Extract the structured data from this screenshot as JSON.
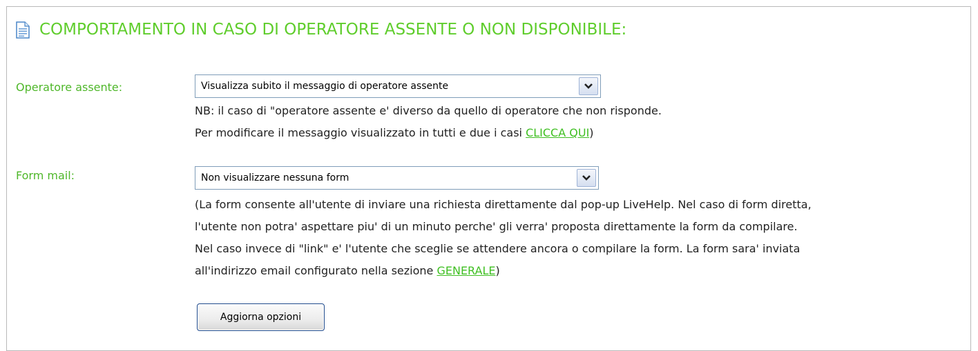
{
  "section": {
    "title": "COMPORTAMENTO IN CASO DI OPERATORE ASSENTE O NON DISPONIBILE:",
    "icon": "document-icon"
  },
  "operatore_assente": {
    "label": "Operatore assente:",
    "selected": "Visualizza subito il messaggio di operatore assente",
    "note_line1": "NB: il caso di \"operatore assente e' diverso da quello di operatore che non risponde.",
    "note_line2_prefix": "Per modificare il messaggio visualizzato in tutti e due i casi ",
    "note_link": "CLICCA QUI",
    "note_line2_suffix": ")"
  },
  "form_mail": {
    "label": "Form mail:",
    "selected": "Non visualizzare nessuna form",
    "desc_line1": "(La form consente all'utente di inviare una richiesta direttamente dal pop-up LiveHelp. Nel caso di form diretta,",
    "desc_line2": "l'utente non potra' aspettare piu' di un minuto perche' gli verra' proposta direttamente la form da compilare.",
    "desc_line3": "Nel caso invece di \"link\" e' l'utente che sceglie se attendere ancora o compilare la form. La form sara' inviata",
    "desc_line4_prefix": "all'indirizzo email configurato nella sezione ",
    "desc_link": "GENERALE",
    "desc_line4_suffix": ")"
  },
  "actions": {
    "submit_label": "Aggiorna opzioni"
  },
  "colors": {
    "title": "#5fcd2c",
    "label": "#4fb72a",
    "link": "#3fbf22",
    "text": "#222222",
    "border": "#b9b9b9"
  }
}
